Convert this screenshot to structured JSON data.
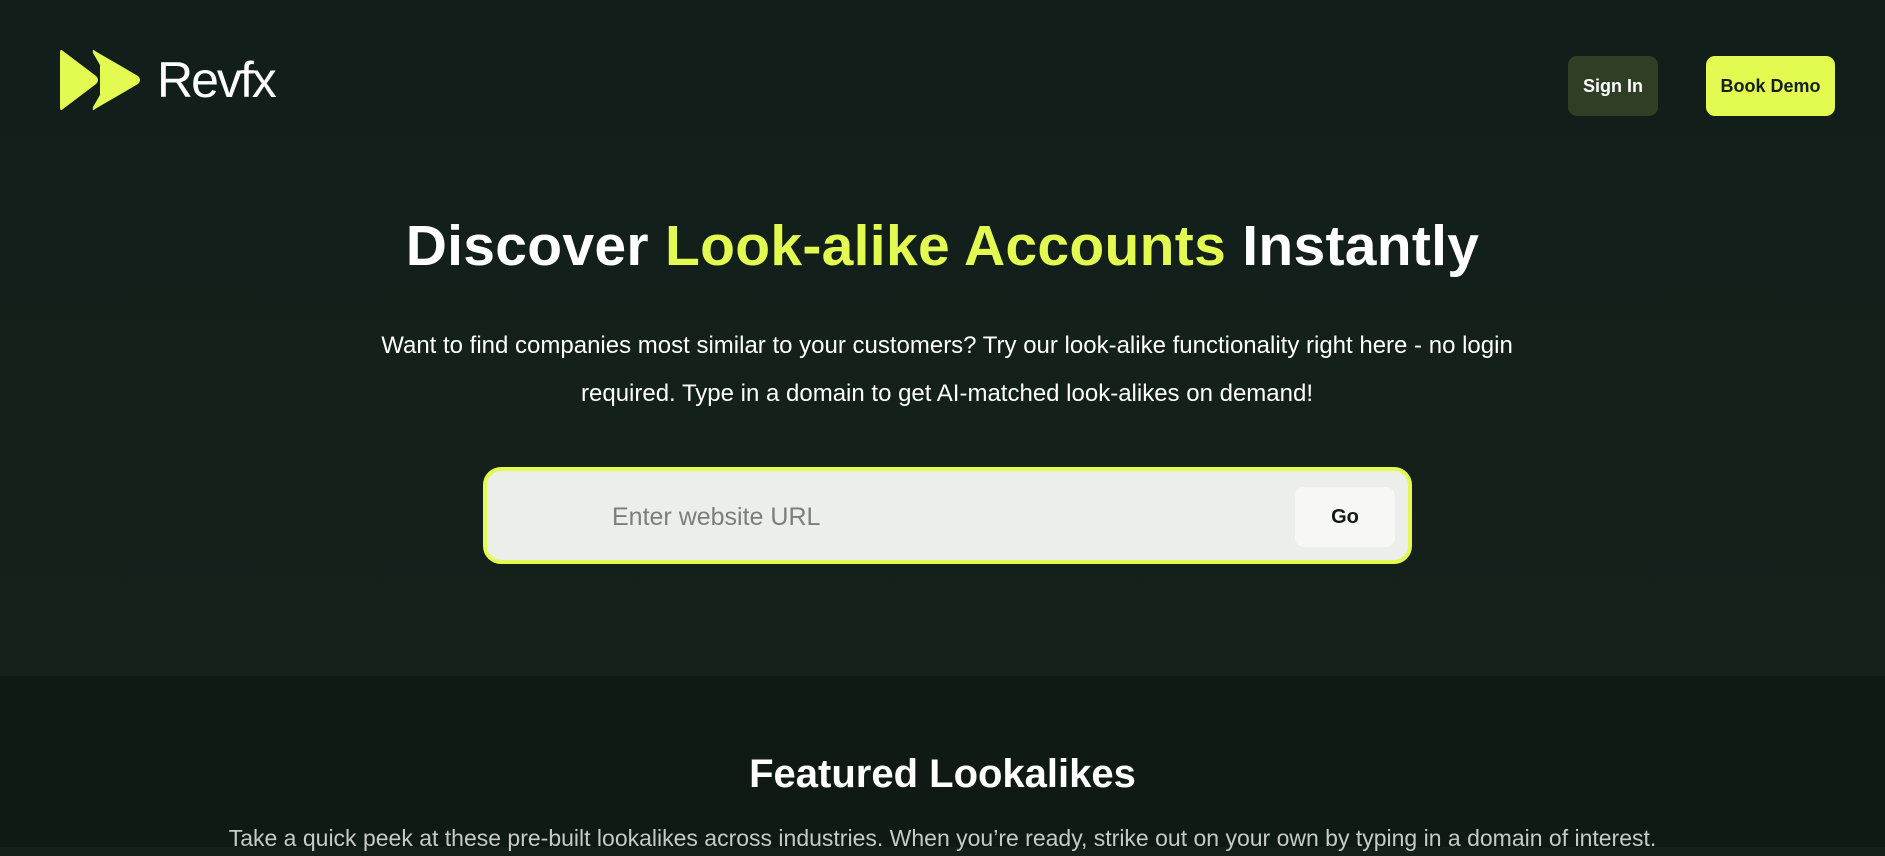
{
  "brand": {
    "name": "Revfx",
    "accent_color": "#e3fa50",
    "background_color": "#142019",
    "logo_icon": "double-chevron-forward-icon"
  },
  "nav": {
    "sign_in_label": "Sign In",
    "book_demo_label": "Book Demo"
  },
  "hero": {
    "headline_before": "Discover ",
    "headline_accent": "Look-alike Accounts",
    "headline_after": " Instantly",
    "subtext": "Want to find companies most similar to your customers? Try our look-alike functionality right here - no login required. Type in a domain to get AI-matched look-alikes on demand!"
  },
  "search": {
    "placeholder": "Enter website URL",
    "value": "",
    "go_label": "Go"
  },
  "featured": {
    "title": "Featured Lookalikes",
    "subtitle": "Take a quick peek at these pre-built lookalikes across industries. When you’re ready, strike out on your own by typing in a domain of interest."
  }
}
